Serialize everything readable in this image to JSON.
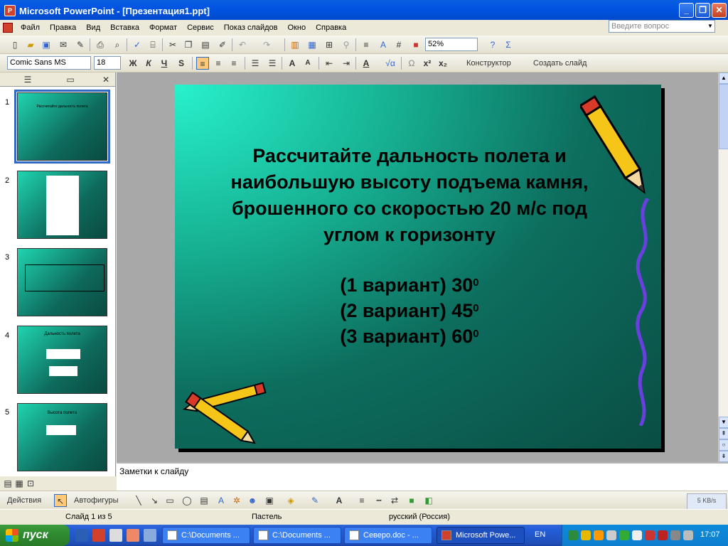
{
  "window": {
    "title": "Microsoft PowerPoint - [Презентация1.ppt]",
    "minimize": "_",
    "maximize": "❐",
    "close": "✕"
  },
  "menu": [
    "Файл",
    "Правка",
    "Вид",
    "Вставка",
    "Формат",
    "Сервис",
    "Показ слайдов",
    "Окно",
    "Справка"
  ],
  "help_placeholder": "Введите вопрос",
  "standard_toolbar": {
    "zoom": "52%"
  },
  "format_toolbar": {
    "font": "Comic Sans MS",
    "size": "18",
    "bold": "Ж",
    "italic": "К",
    "underline": "Ч",
    "shadow": "S",
    "designer": "Конструктор",
    "new_slide": "Создать слайд"
  },
  "slide": {
    "title_lines": [
      "Рассчитайте дальность полета и",
      "наибольшую высоту подъема камня,",
      "брошенного со скоростью 20 м/с под",
      "углом к горизонту"
    ],
    "options": [
      {
        "text": "(1 вариант) 30",
        "sup": "0"
      },
      {
        "text": "(2 вариант) 45",
        "sup": "0"
      },
      {
        "text": "(3 вариант) 60",
        "sup": "0"
      }
    ]
  },
  "thumbnails": [
    {
      "num": "1",
      "caption": "Рассчитайте дальность полета"
    },
    {
      "num": "2",
      "caption": ""
    },
    {
      "num": "3",
      "caption": ""
    },
    {
      "num": "4",
      "caption": "Дальность полета"
    },
    {
      "num": "5",
      "caption": "Высота полета"
    }
  ],
  "notes_placeholder": "Заметки к слайду",
  "drawing_toolbar": {
    "actions": "Действия",
    "autoshapes": "Автофигуры"
  },
  "status": {
    "slide": "Слайд 1 из 5",
    "design": "Пастель",
    "language": "русский (Россия)"
  },
  "netspeed": "5 KB/s",
  "taskbar": {
    "start": "пуск",
    "tasks": [
      "C:\\Documents ...",
      "C:\\Documents ...",
      "Северо.doc - ...",
      "Microsoft Powe..."
    ],
    "lang": "EN",
    "clock": "17:07"
  }
}
